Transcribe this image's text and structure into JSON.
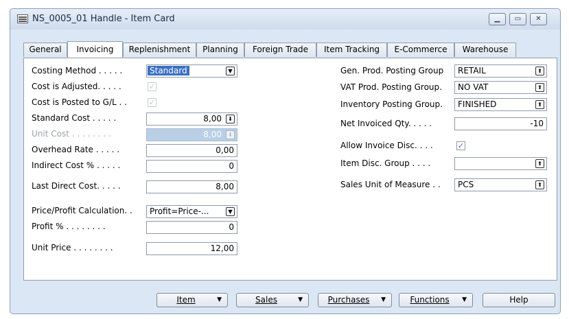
{
  "window": {
    "title": "NS_0005_01 Handle - Item Card"
  },
  "tabs": [
    {
      "label": "General"
    },
    {
      "label": "Invoicing"
    },
    {
      "label": "Replenishment"
    },
    {
      "label": "Planning"
    },
    {
      "label": "Foreign Trade"
    },
    {
      "label": "Item Tracking"
    },
    {
      "label": "E-Commerce"
    },
    {
      "label": "Warehouse"
    }
  ],
  "left": {
    "costing_method": {
      "label": "Costing Method . . . . .",
      "value": "Standard"
    },
    "cost_is_adjusted": {
      "label": "Cost is Adjusted. . . . .",
      "checked": true
    },
    "cost_posted_gl": {
      "label": "Cost is Posted to G/L  . .",
      "checked": true
    },
    "standard_cost": {
      "label": "Standard Cost  . . . . .",
      "value": "8,00"
    },
    "unit_cost": {
      "label": "Unit Cost . . . . . . . .",
      "value": "8,00"
    },
    "overhead_rate": {
      "label": "Overhead Rate . . . . .",
      "value": "0,00"
    },
    "indirect_cost": {
      "label": "Indirect Cost % . . . . .",
      "value": "0"
    },
    "last_direct_cost": {
      "label": "Last Direct Cost. . . . .",
      "value": "8,00"
    },
    "price_profit_calc": {
      "label": "Price/Profit Calculation. .",
      "value": "Profit=Price-..."
    },
    "profit_pct": {
      "label": "Profit % . . . . . . . .",
      "value": "0"
    },
    "unit_price": {
      "label": "Unit Price . . . . . . . .",
      "value": "12,00"
    }
  },
  "right": {
    "gen_prod_posting_group": {
      "label": "Gen. Prod. Posting Group",
      "value": "RETAIL"
    },
    "vat_prod_posting_group": {
      "label": "VAT Prod. Posting Group.",
      "value": "NO VAT"
    },
    "inventory_posting_group": {
      "label": "Inventory Posting Group.",
      "value": "FINISHED"
    },
    "net_invoiced_qty": {
      "label": "Net Invoiced Qty. . . . .",
      "value": "-10"
    },
    "allow_invoice_disc": {
      "label": "Allow Invoice Disc.  . . .",
      "checked": true
    },
    "item_disc_group": {
      "label": "Item Disc. Group  . . . .",
      "value": ""
    },
    "sales_unit_of_measure": {
      "label": "Sales Unit of Measure . .",
      "value": "PCS"
    }
  },
  "buttons": {
    "item": "Item",
    "sales": "Sales",
    "purchases": "Purchases",
    "functions": "Functions",
    "help": "Help"
  },
  "icons": {
    "dropdown": "dropdown-arrow-icon",
    "lookup": "lookup-arrow-icon",
    "drilldown": "drilldown-arrow-icon",
    "check": "checkmark-icon"
  }
}
